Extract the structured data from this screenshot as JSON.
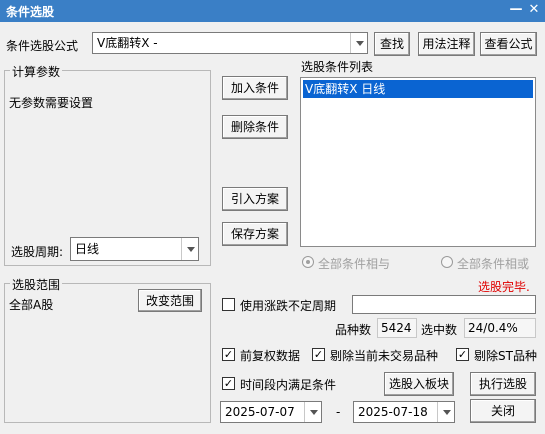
{
  "window": {
    "title": "条件选股"
  },
  "formula": {
    "label": "条件选股公式",
    "value": "V底翻转X  -",
    "find_button": "查找",
    "usage_button": "用法注释",
    "view_button": "查看公式"
  },
  "params": {
    "group_title": "计算参数",
    "message": "无参数需要设置",
    "period_label": "选股周期:",
    "period_value": "日线"
  },
  "actions": {
    "add_condition": "加入条件",
    "delete_condition": "删除条件",
    "import_plan": "引入方案",
    "save_plan": "保存方案"
  },
  "condition_list": {
    "title": "选股条件列表",
    "items": [
      "V底翻转X  日线"
    ]
  },
  "logic": {
    "all_and": "全部条件相与",
    "all_or": "全部条件相或"
  },
  "status": {
    "text": "选股完毕.",
    "color": "#e00000"
  },
  "range": {
    "group_title": "选股范围",
    "value": "全部A股",
    "change_button": "改变范围"
  },
  "variable_period": {
    "label": "使用涨跌不定周期",
    "checked": false
  },
  "stats": {
    "count_label": "品种数",
    "count_value": "5424",
    "selected_label": "选中数",
    "selected_value": "24/0.4%"
  },
  "options": {
    "prior_rights": "前复权数据",
    "exclude_non_trading": "剔除当前未交易品种",
    "exclude_st": "剔除ST品种",
    "period_satisfy": "时间段内满足条件"
  },
  "buttons": {
    "select_to_block": "选股入板块",
    "execute": "执行选股",
    "close": "关闭"
  },
  "dates": {
    "start": "2025-07-07",
    "separator": "-",
    "end": "2025-07-18"
  },
  "colors": {
    "title_bar": "#3a7fc6",
    "selection": "#0a64d2"
  },
  "icons": {
    "check": "✓",
    "minimize": "—",
    "close": "✕"
  }
}
